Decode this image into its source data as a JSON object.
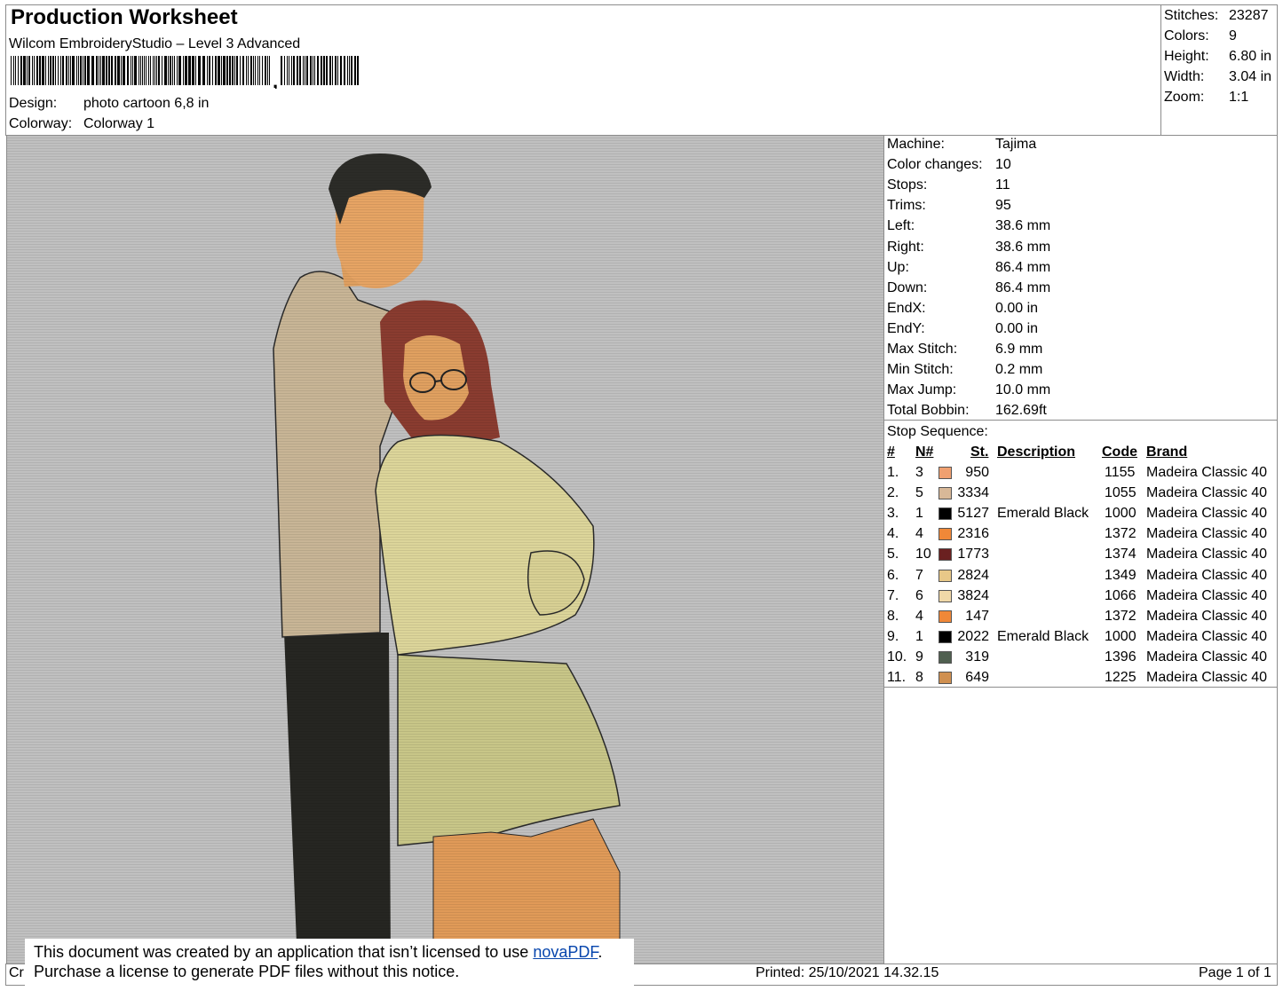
{
  "header": {
    "title": "Production Worksheet",
    "software": "Wilcom EmbroideryStudio – Level 3 Advanced",
    "barcode_suffix": ",",
    "design_label": "Design:",
    "design_value": "photo cartoon 6,8 in",
    "colorway_label": "Colorway:",
    "colorway_value": "Colorway 1"
  },
  "stats": [
    {
      "label": "Stitches:",
      "value": "23287"
    },
    {
      "label": "Colors:",
      "value": "9"
    },
    {
      "label": "Height:",
      "value": "6.80 in"
    },
    {
      "label": "Width:",
      "value": "3.04 in"
    },
    {
      "label": "Zoom:",
      "value": "1:1"
    }
  ],
  "properties": [
    {
      "label": "Machine:",
      "value": "Tajima"
    },
    {
      "label": "Color changes:",
      "value": "10"
    },
    {
      "label": "Stops:",
      "value": "11"
    },
    {
      "label": "Trims:",
      "value": "95"
    },
    {
      "label": "Left:",
      "value": "38.6 mm"
    },
    {
      "label": "Right:",
      "value": "38.6 mm"
    },
    {
      "label": "Up:",
      "value": "86.4 mm"
    },
    {
      "label": "Down:",
      "value": "86.4 mm"
    },
    {
      "label": "EndX:",
      "value": "0.00 in"
    },
    {
      "label": "EndY:",
      "value": "0.00 in"
    },
    {
      "label": "Max Stitch:",
      "value": "6.9 mm"
    },
    {
      "label": "Min Stitch:",
      "value": "0.2 mm"
    },
    {
      "label": "Max Jump:",
      "value": "10.0 mm"
    },
    {
      "label": "Total Bobbin:",
      "value": "162.69ft"
    }
  ],
  "stop_sequence": {
    "label": "Stop Sequence:",
    "headers": {
      "num": "#",
      "n": "N#",
      "st": "St.",
      "desc": "Description",
      "code": "Code",
      "brand": "Brand"
    },
    "rows": [
      {
        "num": "1.",
        "n": "3",
        "color": "#f0a070",
        "st": "950",
        "desc": "",
        "code": "1155",
        "brand": "Madeira Classic 40"
      },
      {
        "num": "2.",
        "n": "5",
        "color": "#d8b898",
        "st": "3334",
        "desc": "",
        "code": "1055",
        "brand": "Madeira Classic 40"
      },
      {
        "num": "3.",
        "n": "1",
        "color": "#000000",
        "st": "5127",
        "desc": "Emerald Black",
        "code": "1000",
        "brand": "Madeira Classic 40"
      },
      {
        "num": "4.",
        "n": "4",
        "color": "#f08838",
        "st": "2316",
        "desc": "",
        "code": "1372",
        "brand": "Madeira Classic 40"
      },
      {
        "num": "5.",
        "n": "10",
        "color": "#6a2020",
        "st": "1773",
        "desc": "",
        "code": "1374",
        "brand": "Madeira Classic 40"
      },
      {
        "num": "6.",
        "n": "7",
        "color": "#e8c888",
        "st": "2824",
        "desc": "",
        "code": "1349",
        "brand": "Madeira Classic 40"
      },
      {
        "num": "7.",
        "n": "6",
        "color": "#f0d8a8",
        "st": "3824",
        "desc": "",
        "code": "1066",
        "brand": "Madeira Classic 40"
      },
      {
        "num": "8.",
        "n": "4",
        "color": "#f08838",
        "st": "147",
        "desc": "",
        "code": "1372",
        "brand": "Madeira Classic 40"
      },
      {
        "num": "9.",
        "n": "1",
        "color": "#000000",
        "st": "2022",
        "desc": "Emerald Black",
        "code": "1000",
        "brand": "Madeira Classic 40"
      },
      {
        "num": "10.",
        "n": "9",
        "color": "#506050",
        "st": "319",
        "desc": "",
        "code": "1396",
        "brand": "Madeira Classic 40"
      },
      {
        "num": "11.",
        "n": "8",
        "color": "#d09050",
        "st": "649",
        "desc": "",
        "code": "1225",
        "brand": "Madeira Classic 40"
      }
    ]
  },
  "notice": {
    "line1_prefix": "This document was created by an application that isn’t licensed to use ",
    "link": "novaPDF",
    "line1_suffix": ".",
    "line2": "Purchase a license to generate PDF files without this notice."
  },
  "footer": {
    "left_fragment": "Cr",
    "printed": "Printed: 25/10/2021 14.32.15",
    "page": "Page 1 of 1"
  },
  "colors": {
    "canvas_bg": "#c0c0c0",
    "border": "#8c8c8c",
    "link": "#0645ad"
  }
}
